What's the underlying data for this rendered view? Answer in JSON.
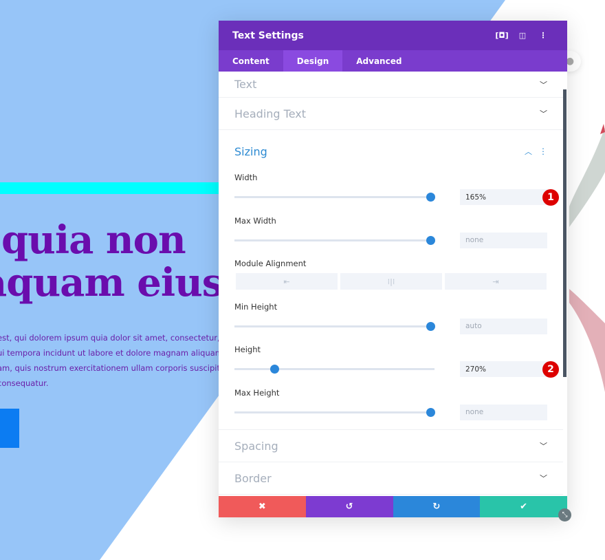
{
  "colors": {
    "background_blue": "#97c5f8",
    "cyan_bar": "#00ffff",
    "headline": "#6a0dad",
    "header": "#6b2fba",
    "tabs": "#7a3ccd",
    "accent": "#2b87da",
    "cancel": "#f05a5a",
    "undo": "#7d3bd1",
    "redo": "#2b87da",
    "save": "#29c4a9"
  },
  "page": {
    "headline": [
      "quia non",
      "aquam eius"
    ],
    "body": [
      "est, qui dolorem ipsum quia dolor sit amet, consectetur, adipisci",
      "ui tempora incidunt ut labore et dolore magnam aliquam quaerat",
      "am, quis nostrum exercitationem ullam corporis suscipit laboriosam",
      "consequatur."
    ]
  },
  "panel": {
    "title": "Text Settings",
    "header_icons": [
      "expand-icon",
      "columns-icon",
      "more-icon"
    ],
    "tabs": [
      {
        "label": "Content"
      },
      {
        "label": "Design",
        "active": true
      },
      {
        "label": "Advanced"
      }
    ],
    "sections_top": [
      "Text",
      "Heading Text"
    ],
    "sizing": {
      "title": "Sizing",
      "width": {
        "label": "Width",
        "value": "165%",
        "slider": 1.0,
        "badge": "1"
      },
      "max_width": {
        "label": "Max Width",
        "value": "none",
        "slider": 1.0
      },
      "module_alignment": {
        "label": "Module Alignment",
        "options": [
          "left",
          "center",
          "right"
        ]
      },
      "min_height": {
        "label": "Min Height",
        "value": "auto",
        "slider": 1.0
      },
      "height": {
        "label": "Height",
        "value": "270%",
        "slider": 0.2,
        "badge": "2"
      },
      "max_height": {
        "label": "Max Height",
        "value": "none",
        "slider": 1.0
      }
    },
    "sections_bottom": [
      "Spacing",
      "Border"
    ],
    "footer": [
      "cancel",
      "undo",
      "redo",
      "save"
    ]
  }
}
